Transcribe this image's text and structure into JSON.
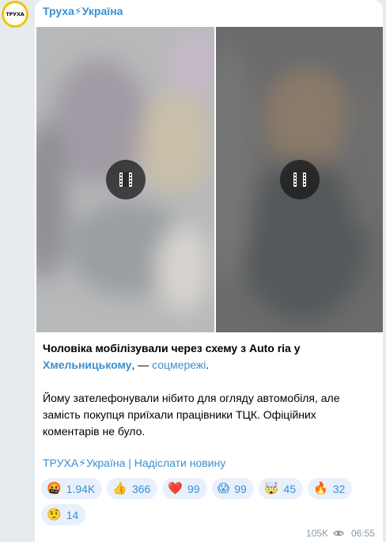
{
  "channel": {
    "avatar_text": "ТРУХА",
    "title": "Труха⚡Україна"
  },
  "media": [
    {
      "type": "video",
      "icon": "film-icon"
    },
    {
      "type": "video",
      "icon": "film-icon"
    }
  ],
  "post": {
    "line1_bold": "Чоловіка мобілізували через схему з Auto ria у",
    "link_city": "Хмельницькому",
    "line2_mid": ", — ",
    "link_source": "соцмережі",
    "line2_end": ".",
    "para2": "Йому зателефонували нібито для огляду автомобіля, але замість покупця приїхали працівники ТЦК. Офіційних коментарів не було."
  },
  "footer": {
    "channel_link": "ТРУХА⚡Україна",
    "separator": " | ",
    "submit_link": "Надіслати новину"
  },
  "reactions": [
    {
      "emoji": "🤬",
      "count": "1.94K"
    },
    {
      "emoji": "👍",
      "count": "366"
    },
    {
      "emoji": "❤️",
      "count": "99"
    },
    {
      "emoji": "😱",
      "count": "99"
    },
    {
      "emoji": "🤯",
      "count": "45"
    },
    {
      "emoji": "🔥",
      "count": "32"
    },
    {
      "emoji": "🤨",
      "count": "14"
    }
  ],
  "meta": {
    "views": "105K",
    "time": "06:55"
  },
  "colors": {
    "accent": "#3a8fd0",
    "background": "#e6ebee",
    "reaction_bg": "#e8f1fb"
  }
}
